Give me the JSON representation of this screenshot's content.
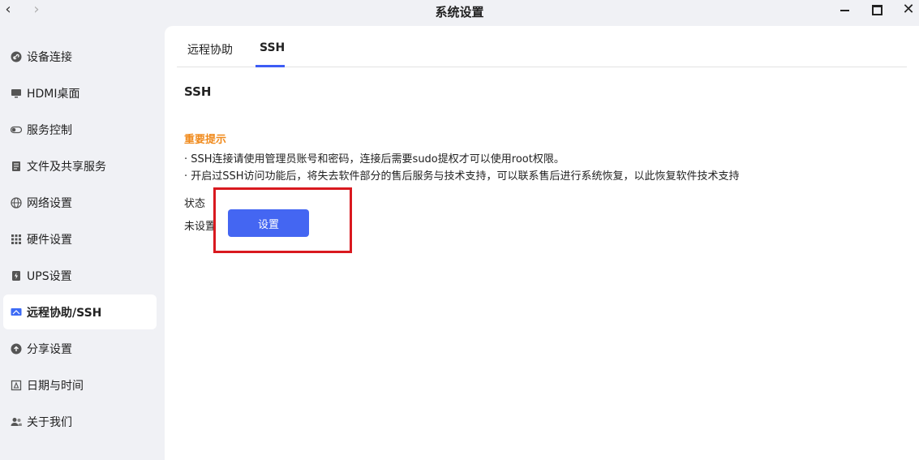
{
  "window": {
    "title": "系统设置",
    "back_icon": "‹",
    "forward_icon": "›",
    "close_icon": "✕"
  },
  "sidebar": {
    "items": [
      {
        "label": "设备连接",
        "icon": "link-icon"
      },
      {
        "label": "HDMI桌面",
        "icon": "monitor-icon"
      },
      {
        "label": "服务控制",
        "icon": "toggle-icon"
      },
      {
        "label": "文件及共享服务",
        "icon": "file-share-icon"
      },
      {
        "label": "网络设置",
        "icon": "globe-icon"
      },
      {
        "label": "硬件设置",
        "icon": "grid-icon"
      },
      {
        "label": "UPS设置",
        "icon": "ups-icon"
      },
      {
        "label": "远程协助/SSH",
        "icon": "remote-icon",
        "active": true
      },
      {
        "label": "分享设置",
        "icon": "share-icon"
      },
      {
        "label": "日期与时间",
        "icon": "calendar-icon"
      },
      {
        "label": "关于我们",
        "icon": "users-icon"
      }
    ]
  },
  "tabs": [
    {
      "label": "远程协助"
    },
    {
      "label": "SSH",
      "active": true
    }
  ],
  "main": {
    "section_title": "SSH",
    "notice_title": "重要提示",
    "notice_lines": [
      "· SSH连接请使用管理员账号和密码，连接后需要sudo提权才可以使用root权限。",
      "· 开启过SSH访问功能后，将失去软件部分的售后服务与技术支持，可以联系售后进行系统恢复，以此恢复软件技术支持"
    ],
    "status_label": "状态",
    "status_value": "未设置",
    "setup_button": "设置"
  },
  "colors": {
    "accent": "#4466f2",
    "notice": "#f08a1c",
    "highlight": "#d9191f",
    "background": "#f0f1f5"
  }
}
